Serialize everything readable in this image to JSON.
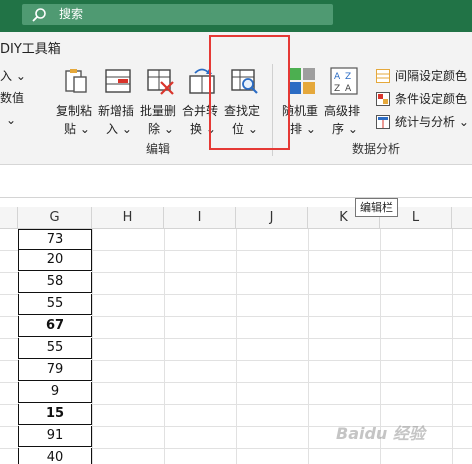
{
  "search": {
    "label": "搜索"
  },
  "tabs": {
    "diy": "DIY工具箱"
  },
  "left_controls": {
    "insert": "入 ⌄",
    "values": "数值",
    "chevron": "⌄"
  },
  "ribbon_buttons": [
    {
      "id": "copy-paste",
      "line1": "复制粘",
      "line2": "贴 ⌄"
    },
    {
      "id": "add-insert",
      "line1": "新增插",
      "line2": "入 ⌄"
    },
    {
      "id": "batch-delete",
      "line1": "批量删",
      "line2": "除 ⌄"
    },
    {
      "id": "merge-convert",
      "line1": "合并转",
      "line2": "换 ⌄"
    },
    {
      "id": "find-locate",
      "line1": "查找定",
      "line2": "位 ⌄"
    },
    {
      "id": "random-rearrange",
      "line1": "随机重",
      "line2": "排 ⌄"
    },
    {
      "id": "advanced-sort",
      "line1": "高级排",
      "line2": "序 ⌄"
    }
  ],
  "small_items": [
    {
      "id": "interval-color",
      "label": "间隔设定颜色"
    },
    {
      "id": "condition-color",
      "label": "条件设定颜色"
    },
    {
      "id": "stats-analysis",
      "label": "统计与分析 ⌄"
    }
  ],
  "groups": {
    "edit": "编辑",
    "data_analysis": "数据分析"
  },
  "tooltip": "编辑栏",
  "columns": [
    "G",
    "H",
    "I",
    "J",
    "K",
    "L"
  ],
  "cells": [
    {
      "value": "73",
      "bold": false
    },
    {
      "value": "20",
      "bold": false
    },
    {
      "value": "58",
      "bold": false
    },
    {
      "value": "55",
      "bold": false
    },
    {
      "value": "67",
      "bold": true
    },
    {
      "value": "55",
      "bold": false
    },
    {
      "value": "79",
      "bold": false
    },
    {
      "value": "9",
      "bold": false
    },
    {
      "value": "15",
      "bold": true
    },
    {
      "value": "91",
      "bold": false
    },
    {
      "value": "40",
      "bold": false
    }
  ],
  "watermark": "Baidu 经验",
  "colors": {
    "titlebar": "#217346",
    "highlight": "#e53935",
    "ribbon": "#f3f3f3"
  }
}
